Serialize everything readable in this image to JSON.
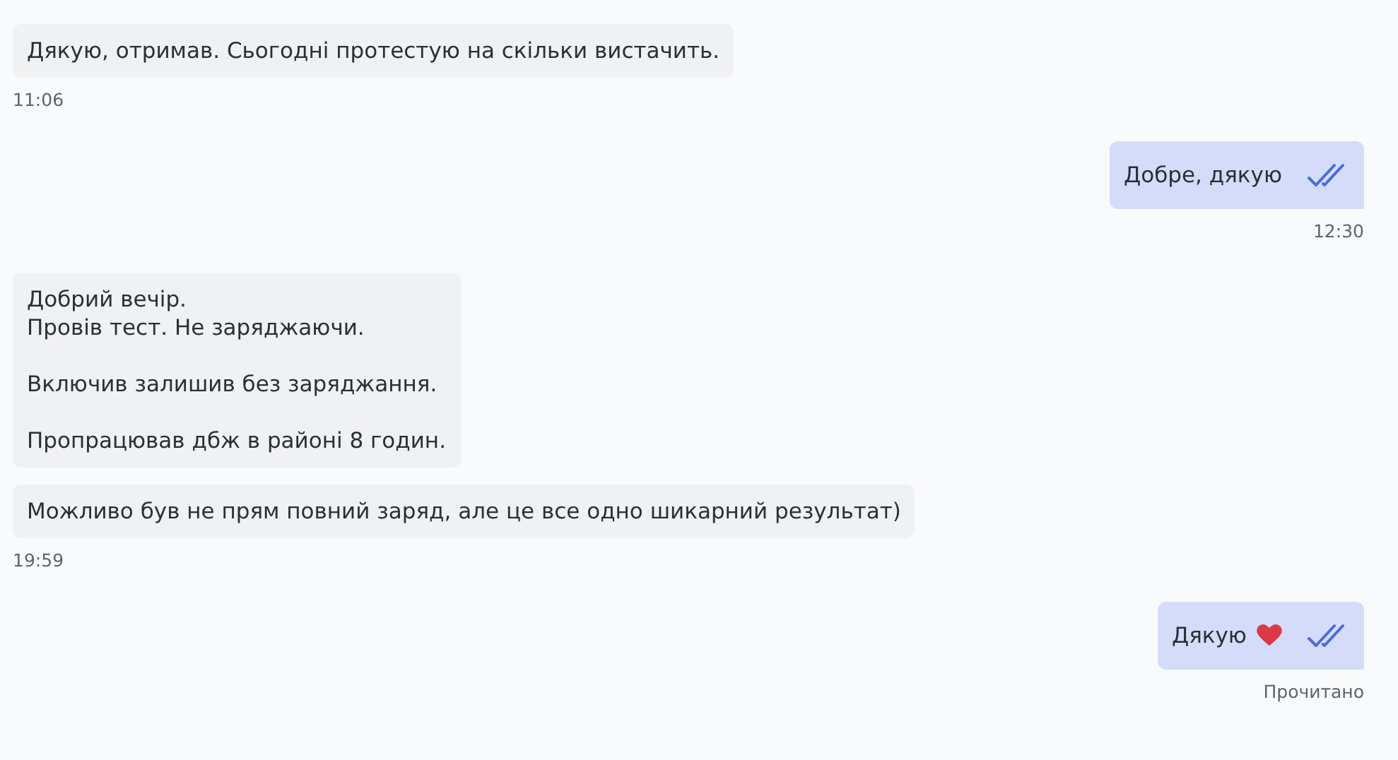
{
  "groups": [
    {
      "kind": "incoming",
      "messages": [
        {
          "text": "Дякую, отримав. Сьогодні протестую на скільки вистачить."
        }
      ],
      "footer": "11:06"
    },
    {
      "kind": "outgoing",
      "messages": [
        {
          "text": "Добре, дякую",
          "heart": false,
          "read": true
        }
      ],
      "footer": "12:30"
    },
    {
      "kind": "incoming",
      "messages": [
        {
          "text": "Добрий вечір.\nПровів тест. Не заряджаючи.\n\nВключив залишив без заряджання.\n\nПропрацював дбж в районі 8 годин."
        },
        {
          "text": "Можливо був не прям повний заряд, але це все одно шикарний результат)"
        }
      ],
      "footer": "19:59"
    },
    {
      "kind": "outgoing",
      "messages": [
        {
          "text": "Дякую",
          "heart": true,
          "read": true
        }
      ],
      "footer": "Прочитано"
    }
  ]
}
